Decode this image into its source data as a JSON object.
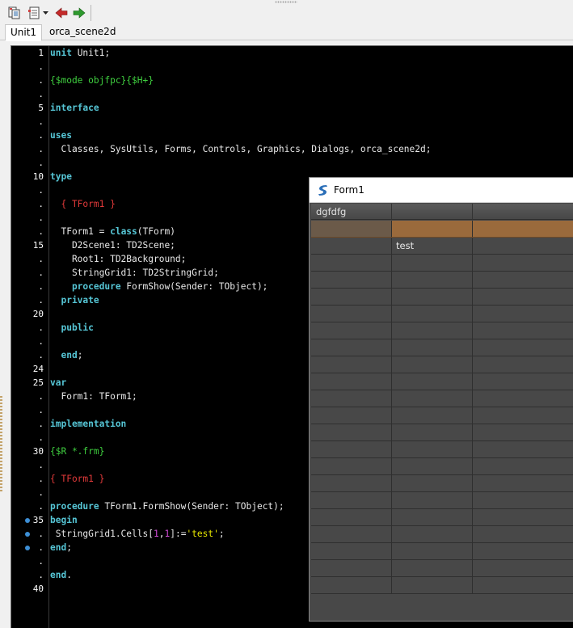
{
  "toolbar": {
    "buttons": [
      {
        "name": "toggle-form-unit-icon"
      },
      {
        "name": "view-units-icon"
      },
      {
        "name": "dropdown-arrow-icon"
      },
      {
        "name": "jump-back-icon"
      },
      {
        "name": "jump-forward-icon"
      }
    ]
  },
  "tabs": [
    {
      "label": "Unit1",
      "active": true
    },
    {
      "label": "orca_scene2d",
      "active": false
    }
  ],
  "editor": {
    "gutter": [
      "1",
      ".",
      ".",
      ".",
      "5",
      ".",
      ".",
      ".",
      ".",
      "10",
      ".",
      ".",
      ".",
      ".",
      "15",
      ".",
      ".",
      ".",
      ".",
      "20",
      ".",
      ".",
      ".",
      "24",
      "25",
      ".",
      ".",
      ".",
      ".",
      "30",
      ".",
      ".",
      ".",
      ".",
      "35",
      ".",
      ".",
      ".",
      ".",
      "40"
    ],
    "breakpoint_lines": [
      35,
      36,
      37
    ],
    "lines": [
      [
        {
          "c": "kw",
          "t": "unit"
        },
        {
          "c": "sym",
          "t": " Unit1;"
        }
      ],
      [],
      [
        {
          "c": "dir",
          "t": "{$mode objfpc}{$H+}"
        }
      ],
      [],
      [
        {
          "c": "kw",
          "t": "interface"
        }
      ],
      [],
      [
        {
          "c": "kw",
          "t": "uses"
        }
      ],
      [
        {
          "c": "sym",
          "t": "  Classes, SysUtils, Forms, Controls, Graphics, Dialogs, orca_scene2d;"
        }
      ],
      [],
      [
        {
          "c": "kw",
          "t": "type"
        }
      ],
      [],
      [
        {
          "c": "cmt",
          "t": "  { TForm1 }"
        }
      ],
      [],
      [
        {
          "c": "sym",
          "t": "  TForm1 = "
        },
        {
          "c": "kw",
          "t": "class"
        },
        {
          "c": "sym",
          "t": "(TForm)"
        }
      ],
      [
        {
          "c": "sym",
          "t": "    D2Scene1: TD2Scene;"
        }
      ],
      [
        {
          "c": "sym",
          "t": "    Root1: TD2Background;"
        }
      ],
      [
        {
          "c": "sym",
          "t": "    StringGrid1: TD2StringGrid;"
        }
      ],
      [
        {
          "c": "kw",
          "t": "    procedure"
        },
        {
          "c": "sym",
          "t": " FormShow(Sender: TObject);"
        }
      ],
      [
        {
          "c": "kw",
          "t": "  private"
        }
      ],
      [],
      [
        {
          "c": "kw",
          "t": "  public"
        }
      ],
      [],
      [
        {
          "c": "kw",
          "t": "  end"
        },
        {
          "c": "sym",
          "t": ";"
        }
      ],
      [],
      [
        {
          "c": "kw",
          "t": "var"
        }
      ],
      [
        {
          "c": "sym",
          "t": "  Form1: TForm1;"
        }
      ],
      [],
      [
        {
          "c": "kw",
          "t": "implementation"
        }
      ],
      [],
      [
        {
          "c": "dir",
          "t": "{$R *.frm}"
        }
      ],
      [],
      [
        {
          "c": "cmt",
          "t": "{ TForm1 }"
        }
      ],
      [],
      [
        {
          "c": "kw",
          "t": "procedure"
        },
        {
          "c": "sym",
          "t": " TForm1.FormShow(Sender: TObject);"
        }
      ],
      [
        {
          "c": "kw",
          "t": "begin"
        }
      ],
      [
        {
          "c": "sym",
          "t": " StringGrid1.Cells["
        },
        {
          "c": "num",
          "t": "1"
        },
        {
          "c": "sym",
          "t": ","
        },
        {
          "c": "num",
          "t": "1"
        },
        {
          "c": "sym",
          "t": "]:="
        },
        {
          "c": "str",
          "t": "'test'"
        },
        {
          "c": "sym",
          "t": ";"
        }
      ],
      [
        {
          "c": "kw",
          "t": "end"
        },
        {
          "c": "sym",
          "t": ";"
        }
      ],
      [],
      [
        {
          "c": "kw",
          "t": "end"
        },
        {
          "c": "sym",
          "t": "."
        }
      ],
      []
    ]
  },
  "form": {
    "title": "Form1",
    "grid": {
      "headers": [
        "dgfdfg",
        "",
        ""
      ],
      "row_count": 22,
      "selected_row": 0,
      "cells": [
        {
          "row": 1,
          "col": 1,
          "text": "test"
        }
      ]
    }
  }
}
